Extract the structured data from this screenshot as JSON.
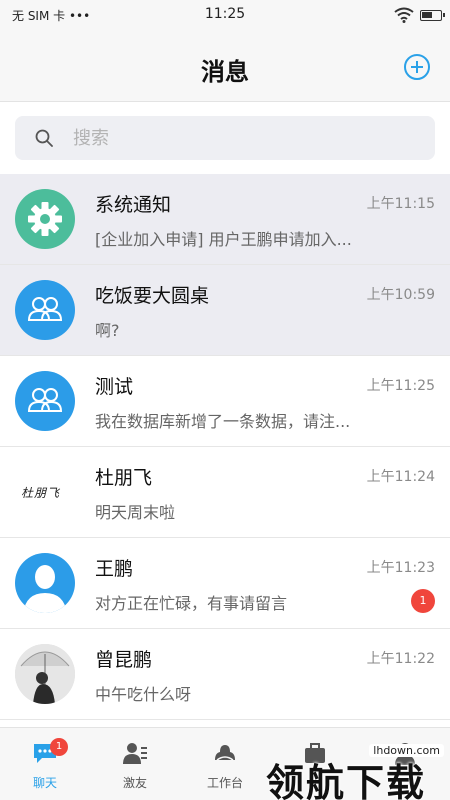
{
  "status_bar": {
    "carrier": "无 SIM 卡 •••",
    "time": "11:25"
  },
  "header": {
    "title": "消息",
    "add_icon": "add-circle-icon"
  },
  "search": {
    "placeholder": "搜索",
    "icon": "search-icon"
  },
  "conversations": [
    {
      "name": "系统通知",
      "time": "上午11:15",
      "preview": "[企业加入申请] 用户王鹏申请加入...",
      "avatar": "gear-icon",
      "shaded": true
    },
    {
      "name": "吃饭要大圆桌",
      "time": "上午10:59",
      "preview": "啊?",
      "avatar": "group-icon",
      "shaded": true
    },
    {
      "name": "测试",
      "time": "上午11:25",
      "preview": "我在数据库新增了一条数据，请注...",
      "avatar": "group-icon",
      "shaded": false
    },
    {
      "name": "杜朋飞",
      "time": "上午11:24",
      "preview": "明天周末啦",
      "avatar": "signature-avatar",
      "avatar_text": "杜朋飞",
      "shaded": false
    },
    {
      "name": "王鹏",
      "time": "上午11:23",
      "preview": "对方正在忙碌，有事请留言",
      "avatar": "person-icon",
      "unread": "1",
      "shaded": false
    },
    {
      "name": "曾昆鹏",
      "time": "上午11:22",
      "preview": "中午吃什么呀",
      "avatar": "photo-avatar",
      "shaded": false
    }
  ],
  "tabs": [
    {
      "label": "聊天",
      "icon": "chat-icon",
      "badge": "1",
      "active": true
    },
    {
      "label": "激友",
      "icon": "contacts-icon",
      "active": false
    },
    {
      "label": "工作台",
      "icon": "workbench-icon",
      "active": false
    },
    {
      "label": "",
      "icon": "briefcase-icon",
      "active": false
    },
    {
      "label": "",
      "icon": "profile-icon",
      "active": false
    }
  ],
  "watermark": {
    "text": "领航下载",
    "url": "lhdown.com"
  },
  "colors": {
    "accent": "#2aa1e8",
    "badge": "#f0463c",
    "system_avatar": "#4cbd9b",
    "group_avatar": "#2c9ce8",
    "shaded_row": "#ececf2"
  }
}
